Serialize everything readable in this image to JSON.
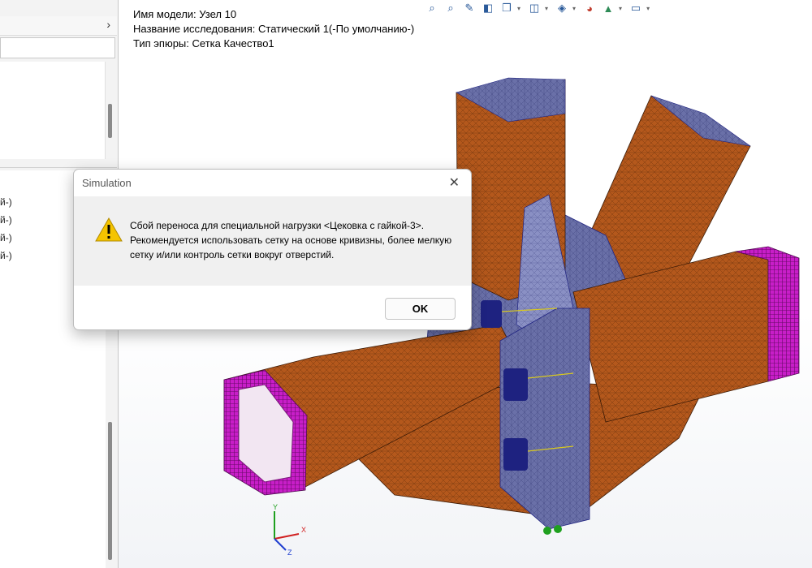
{
  "left_panel": {
    "chevron": "›",
    "tree_items": [
      "й-)",
      "й-)",
      "й-)",
      "й-)"
    ]
  },
  "viewport": {
    "info_lines": [
      "Имя модели: Узел 10",
      "Название исследования: Статический 1(-По умолчанию-)",
      "Тип эпюры: Сетка Качество1"
    ],
    "toolbar_icons": [
      "zoom-fit-icon",
      "zoom-area-icon",
      "previous-view-icon",
      "section-view-icon",
      "view-orientation-icon",
      "display-style-icon",
      "hide-show-icon",
      "edit-appearance-icon",
      "apply-scene-icon",
      "view-settings-icon"
    ]
  },
  "axes": {
    "y": "Y",
    "x": "X",
    "z": "Z"
  },
  "dialog": {
    "title": "Simulation",
    "close_symbol": "✕",
    "message": "Сбой переноса для специальной нагрузки <Цековка с гайкой-3>. Рекомендуется использовать сетку на основе кривизны, более мелкую сетку и/или контроль сетки вокруг отверстий.",
    "ok_label": "OK"
  },
  "colors": {
    "orange_mesh": "#b4581c",
    "blue_mesh": "#6a70a8",
    "dark_blue": "#1e2280",
    "magenta": "#c81ec8",
    "warning": "#f5c400"
  }
}
